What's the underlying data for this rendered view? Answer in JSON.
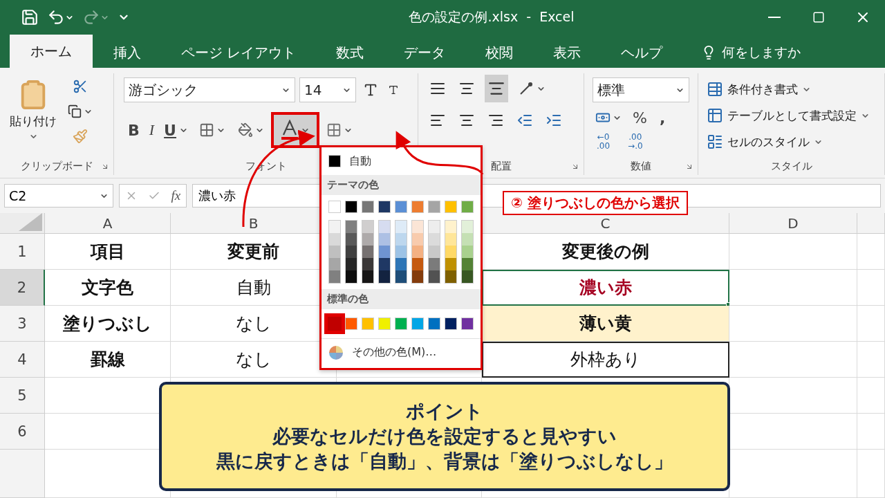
{
  "window": {
    "title": "色の設定の例.xlsx  -  Excel"
  },
  "tabs": [
    {
      "label": "ホーム",
      "selected": true
    },
    {
      "label": "挿入",
      "selected": false
    },
    {
      "label": "ページ レイアウト",
      "selected": false
    },
    {
      "label": "数式",
      "selected": false
    },
    {
      "label": "データ",
      "selected": false
    },
    {
      "label": "校閲",
      "selected": false
    },
    {
      "label": "表示",
      "selected": false
    },
    {
      "label": "ヘルプ",
      "selected": false
    }
  ],
  "tell_me": "何をしますか",
  "ribbon": {
    "clipboard": {
      "paste": "貼り付け",
      "group_label": "クリップボード"
    },
    "font": {
      "font_name": "游ゴシック",
      "font_size": "14",
      "bold": "B",
      "italic": "I",
      "underline": "U",
      "font_color_open": true,
      "group_label": "フォント"
    },
    "alignment": {
      "group_label": "配置"
    },
    "number": {
      "format": "標準",
      "percent": "%",
      "comma": ",",
      "increase_decimal": [
        "←0",
        ".00"
      ],
      "decrease_decimal": [
        ".00",
        "→.0"
      ],
      "group_label": "数値"
    },
    "styles": {
      "items": [
        "条件付き書式",
        "テーブルとして書式設定",
        "セルのスタイル"
      ],
      "group_label": "スタイル"
    }
  },
  "formula_bar": {
    "name_box": "C2",
    "fx": "fx",
    "value": "濃い赤"
  },
  "sheet": {
    "columns": [
      "A",
      "B",
      "C",
      "D"
    ],
    "rows": [
      {
        "number": "1",
        "selected": false,
        "cells": [
          {
            "text": "項目",
            "bold": true
          },
          {
            "text": "変更前",
            "bold": true
          },
          {
            "text": "変更後の例",
            "bold": true
          }
        ]
      },
      {
        "number": "2",
        "selected": true,
        "cells": [
          {
            "text": "文字色",
            "bold": true
          },
          {
            "text": "自動",
            "bold": false
          },
          {
            "text": "濃い赤",
            "bold": true,
            "color": "#a50021",
            "selected": true
          }
        ]
      },
      {
        "number": "3",
        "selected": false,
        "cells": [
          {
            "text": "塗りつぶし",
            "bold": true
          },
          {
            "text": "なし",
            "bold": false
          },
          {
            "text": "薄い黄",
            "bold": true,
            "fill": {
              "color": "#fff2cc"
            }
          }
        ]
      },
      {
        "number": "4",
        "selected": false,
        "cells": [
          {
            "text": "罫線",
            "bold": true
          },
          {
            "text": "なし",
            "bold": false
          },
          {
            "text": "外枠あり",
            "bold": false,
            "outlined": true
          }
        ]
      },
      {
        "number": "5",
        "selected": false,
        "cells": []
      },
      {
        "number": "6",
        "selected": false,
        "cells": []
      }
    ]
  },
  "color_menu": {
    "automatic": "自動",
    "theme_label": "テーマの色",
    "theme_top": [
      {
        "color": "#ffffff"
      },
      {
        "color": "#000000"
      },
      {
        "color": "#767676"
      },
      {
        "color": "#1f3864"
      },
      {
        "color": "#5b8fd5"
      },
      {
        "color": "#ed7d31"
      },
      {
        "color": "#a5a5a5"
      },
      {
        "color": "#ffc000"
      },
      {
        "color": "#70ad47"
      }
    ],
    "theme_shades": [
      {
        "shades": [
          {
            "color": "#f2f2f2"
          },
          {
            "color": "#d9d9d9"
          },
          {
            "color": "#bfbfbf"
          },
          {
            "color": "#a6a6a6"
          },
          {
            "color": "#808080"
          }
        ]
      },
      {
        "shades": [
          {
            "color": "#7f7f7f"
          },
          {
            "color": "#595959"
          },
          {
            "color": "#404040"
          },
          {
            "color": "#262626"
          },
          {
            "color": "#0d0d0d"
          }
        ]
      },
      {
        "shades": [
          {
            "color": "#d0cece"
          },
          {
            "color": "#aeaaaa"
          },
          {
            "color": "#767171"
          },
          {
            "color": "#3b3838"
          },
          {
            "color": "#171616"
          }
        ]
      },
      {
        "shades": [
          {
            "color": "#d6dcf0"
          },
          {
            "color": "#adc0e4"
          },
          {
            "color": "#6f94d2"
          },
          {
            "color": "#1f3864"
          },
          {
            "color": "#132340"
          }
        ]
      },
      {
        "shades": [
          {
            "color": "#deebf7"
          },
          {
            "color": "#bdd7ee"
          },
          {
            "color": "#9dc3e6"
          },
          {
            "color": "#2e75b6"
          },
          {
            "color": "#1f4e79"
          }
        ]
      },
      {
        "shades": [
          {
            "color": "#fbe5d6"
          },
          {
            "color": "#f8cbad"
          },
          {
            "color": "#f4b183"
          },
          {
            "color": "#c55a11"
          },
          {
            "color": "#843c0c"
          }
        ]
      },
      {
        "shades": [
          {
            "color": "#ededed"
          },
          {
            "color": "#dbdbdb"
          },
          {
            "color": "#c9c9c9"
          },
          {
            "color": "#7b7b7b"
          },
          {
            "color": "#525252"
          }
        ]
      },
      {
        "shades": [
          {
            "color": "#fff2cc"
          },
          {
            "color": "#ffe699"
          },
          {
            "color": "#ffd966"
          },
          {
            "color": "#bf9000"
          },
          {
            "color": "#7f6000"
          }
        ]
      },
      {
        "shades": [
          {
            "color": "#e2f0d9"
          },
          {
            "color": "#c5e0b4"
          },
          {
            "color": "#a9d18e"
          },
          {
            "color": "#548235"
          },
          {
            "color": "#385723"
          }
        ]
      }
    ],
    "standard_label": "標準の色",
    "standard": [
      {
        "color": "#c00000",
        "selected": true
      },
      {
        "color": "#ff5a00",
        "selected": false
      },
      {
        "color": "#ffc000",
        "selected": false
      },
      {
        "color": "#f0f000",
        "selected": false
      },
      {
        "color": "#00b050",
        "selected": false
      },
      {
        "color": "#00a6e6",
        "selected": false
      },
      {
        "color": "#0070c0",
        "selected": false
      },
      {
        "color": "#002060",
        "selected": false
      },
      {
        "color": "#7030a0",
        "selected": false
      }
    ],
    "more_colors": "その他の色(M)…"
  },
  "annotation": {
    "label": "② 塗りつぶしの色から選択"
  },
  "point_box": {
    "lines": [
      "ポイント",
      "必要なセルだけ色を設定すると見やすい",
      "黒に戻すときは「自動」、背景は「塗りつぶしなし」"
    ]
  }
}
